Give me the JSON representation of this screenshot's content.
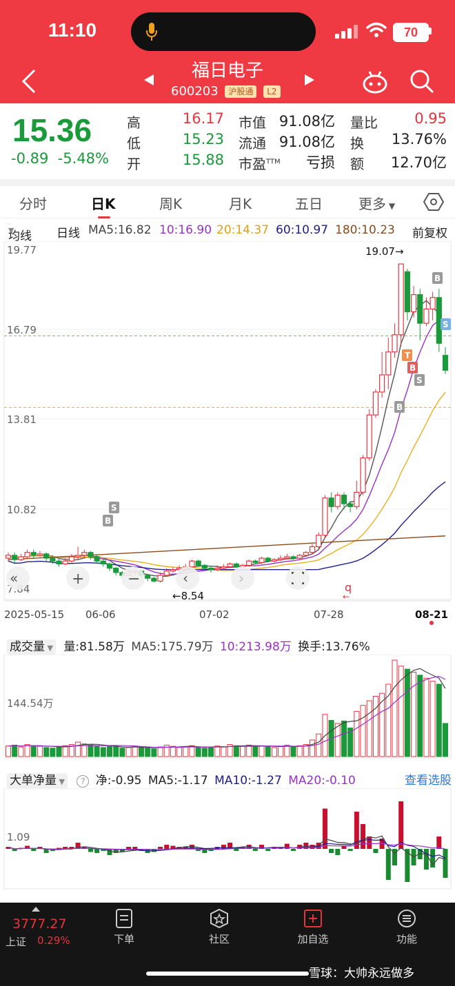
{
  "status": {
    "time": "11:10",
    "battery": "70"
  },
  "header": {
    "name": "福日电子",
    "code": "600203",
    "tag1": "沪股通",
    "tag2": "L2"
  },
  "quote": {
    "price": "15.36",
    "change": "-0.89",
    "change_pct": "-5.48%",
    "stats": [
      {
        "label": "高",
        "value": "16.17",
        "label2": "市值",
        "value2": "91.08亿",
        "label3": "量比",
        "value3": "0.95"
      },
      {
        "label": "低",
        "value": "15.23",
        "label2": "流通",
        "value2": "91.08亿",
        "label3": "换",
        "value3": "13.76%"
      },
      {
        "label": "开",
        "value": "15.88",
        "label2": "市盈",
        "sup2": "TTM",
        "value2": "亏损",
        "label3": "额",
        "value3": "12.70亿"
      }
    ]
  },
  "tabs": [
    "分时",
    "日K",
    "周K",
    "月K",
    "五日",
    "更多"
  ],
  "ma_bar": {
    "selector": "均线",
    "period": "日线",
    "ma5": "MA5:16.82",
    "ma10": "10:16.90",
    "ma20": "20:14.37",
    "ma60": "60:10.97",
    "ma180": "180:10.23",
    "adjust": "前复权"
  },
  "colors": {
    "up": "#e8343f",
    "down": "#1a9a3a",
    "ma5": "#555555",
    "ma10": "#9b30c8",
    "ma20": "#e8b020",
    "ma60": "#1d1d8a",
    "ma180": "#8b4a1a"
  },
  "kline": {
    "y_labels": [
      "19.77",
      "16.79",
      "13.81",
      "10.82",
      "7.84"
    ],
    "high_label": "19.07→",
    "low_label": "←8.54",
    "dates": [
      "2025-05-15",
      "06-06",
      "07-02",
      "07-28",
      "08-21"
    ],
    "markers": {
      "b": "B",
      "s": "S",
      "t": "T"
    },
    "controls": {
      "q": "q"
    },
    "ohlc": [
      [
        8.8,
        8.9,
        8.7,
        9.0
      ],
      [
        8.9,
        8.75,
        8.6,
        9.0
      ],
      [
        8.75,
        8.85,
        8.7,
        8.95
      ],
      [
        8.85,
        9.0,
        8.8,
        9.1
      ],
      [
        9.0,
        8.9,
        8.8,
        9.1
      ],
      [
        8.9,
        8.95,
        8.85,
        9.05
      ],
      [
        8.95,
        8.8,
        8.7,
        9.0
      ],
      [
        8.8,
        8.7,
        8.6,
        8.9
      ],
      [
        8.7,
        8.6,
        8.5,
        8.8
      ],
      [
        8.6,
        8.7,
        8.55,
        8.8
      ],
      [
        8.7,
        8.85,
        8.65,
        8.95
      ],
      [
        8.85,
        8.9,
        8.75,
        9.2
      ],
      [
        8.9,
        9.0,
        8.8,
        9.1
      ],
      [
        9.0,
        8.85,
        8.75,
        9.05
      ],
      [
        8.85,
        8.7,
        8.6,
        8.9
      ],
      [
        8.7,
        8.6,
        8.5,
        8.75
      ],
      [
        8.6,
        8.45,
        8.35,
        8.65
      ],
      [
        8.45,
        8.3,
        8.2,
        8.5
      ],
      [
        8.3,
        8.2,
        8.1,
        8.35
      ],
      [
        8.2,
        8.3,
        8.15,
        8.4
      ],
      [
        8.3,
        8.35,
        8.25,
        8.45
      ],
      [
        8.35,
        8.2,
        8.1,
        8.4
      ],
      [
        8.2,
        8.1,
        8.0,
        8.25
      ],
      [
        8.1,
        8.0,
        7.95,
        8.15
      ],
      [
        8.0,
        8.2,
        7.95,
        8.3
      ],
      [
        8.2,
        8.35,
        8.15,
        8.45
      ],
      [
        8.35,
        8.4,
        8.3,
        8.5
      ],
      [
        8.4,
        8.45,
        8.35,
        8.55
      ],
      [
        8.45,
        8.5,
        8.4,
        8.6
      ],
      [
        8.5,
        8.7,
        8.45,
        8.75
      ],
      [
        8.7,
        8.55,
        8.5,
        8.75
      ],
      [
        8.55,
        8.45,
        8.4,
        8.6
      ],
      [
        8.45,
        8.4,
        8.3,
        8.5
      ],
      [
        8.4,
        8.45,
        8.35,
        8.55
      ],
      [
        8.45,
        8.5,
        8.4,
        8.6
      ],
      [
        8.5,
        8.6,
        8.45,
        8.65
      ],
      [
        8.6,
        8.5,
        8.45,
        8.65
      ],
      [
        8.5,
        8.55,
        8.45,
        8.6
      ],
      [
        8.55,
        8.7,
        8.5,
        8.75
      ],
      [
        8.7,
        8.65,
        8.6,
        8.75
      ],
      [
        8.65,
        8.8,
        8.6,
        8.85
      ],
      [
        8.8,
        8.7,
        8.65,
        8.85
      ],
      [
        8.7,
        8.75,
        8.65,
        8.8
      ],
      [
        8.75,
        8.8,
        8.7,
        8.9
      ],
      [
        8.8,
        8.85,
        8.75,
        8.95
      ],
      [
        8.85,
        8.8,
        8.75,
        8.9
      ],
      [
        8.8,
        8.9,
        8.75,
        8.95
      ],
      [
        8.9,
        9.0,
        8.85,
        9.05
      ],
      [
        9.0,
        9.2,
        8.95,
        9.3
      ],
      [
        9.2,
        9.6,
        9.1,
        9.7
      ],
      [
        9.6,
        10.9,
        9.5,
        11.0
      ],
      [
        10.9,
        10.6,
        10.4,
        11.1
      ],
      [
        10.6,
        11.0,
        10.5,
        11.1
      ],
      [
        11.0,
        10.7,
        10.5,
        11.1
      ],
      [
        10.7,
        10.6,
        10.4,
        10.8
      ],
      [
        10.6,
        11.1,
        10.5,
        11.5
      ],
      [
        11.1,
        12.3,
        11.0,
        12.4
      ],
      [
        12.3,
        13.8,
        12.2,
        14.0
      ],
      [
        13.8,
        14.6,
        13.7,
        14.7
      ],
      [
        14.6,
        15.2,
        14.4,
        16.0
      ],
      [
        15.2,
        16.0,
        14.7,
        16.5
      ],
      [
        16.0,
        16.6,
        15.8,
        17.0
      ],
      [
        16.6,
        19.07,
        16.2,
        19.07
      ],
      [
        18.8,
        17.4,
        17.1,
        18.9
      ],
      [
        17.4,
        18.0,
        17.2,
        18.3
      ],
      [
        18.0,
        17.0,
        16.4,
        18.2
      ],
      [
        17.0,
        17.5,
        16.9,
        17.9
      ],
      [
        17.5,
        17.9,
        17.1,
        18.1
      ],
      [
        17.9,
        16.3,
        16.0,
        18.2
      ],
      [
        15.88,
        15.36,
        15.23,
        16.17
      ]
    ]
  },
  "volume": {
    "selector": "成交量",
    "vol": "量:81.58万",
    "ma5": "MA5:175.79万",
    "ma10": "10:213.98万",
    "turnover": "换手:13.76%",
    "y_label": "144.54万",
    "values": [
      35,
      38,
      32,
      40,
      36,
      34,
      30,
      28,
      33,
      36,
      40,
      48,
      42,
      38,
      34,
      30,
      36,
      32,
      28,
      30,
      34,
      30,
      28,
      26,
      32,
      38,
      34,
      30,
      33,
      36,
      30,
      28,
      32,
      35,
      33,
      40,
      36,
      34,
      38,
      32,
      36,
      34,
      30,
      33,
      38,
      32,
      36,
      40,
      55,
      75,
      140,
      120,
      110,
      118,
      95,
      150,
      170,
      185,
      200,
      210,
      240,
      320,
      300,
      290,
      280,
      270,
      260,
      250,
      240,
      110
    ],
    "up": [
      1,
      0,
      1,
      1,
      0,
      1,
      0,
      0,
      0,
      1,
      1,
      1,
      1,
      0,
      0,
      0,
      0,
      0,
      0,
      1,
      1,
      0,
      0,
      0,
      1,
      1,
      1,
      1,
      1,
      1,
      0,
      0,
      0,
      1,
      1,
      1,
      0,
      1,
      1,
      0,
      1,
      0,
      1,
      1,
      1,
      0,
      1,
      1,
      1,
      1,
      1,
      0,
      1,
      0,
      0,
      1,
      1,
      1,
      1,
      1,
      1,
      1,
      1,
      0,
      1,
      0,
      1,
      1,
      0,
      0
    ]
  },
  "netflow": {
    "selector": "大单净量",
    "net": "净:-0.95",
    "ma5": "MA5:-1.17",
    "ma10": "MA10:-1.27",
    "ma20": "MA20:-0.10",
    "link": "查看选股",
    "y_label": "1.09",
    "values": [
      0.1,
      -0.1,
      0.05,
      0.15,
      -0.1,
      0.1,
      -0.2,
      -0.1,
      0.05,
      0.1,
      0.1,
      0.3,
      0.1,
      -0.15,
      -0.2,
      -0.1,
      -0.3,
      -0.2,
      -0.15,
      0.1,
      0.1,
      -0.1,
      -0.2,
      -0.15,
      0.1,
      0.2,
      0.15,
      0.1,
      0.1,
      0.2,
      -0.1,
      -0.2,
      -0.1,
      0.1,
      0.2,
      0.3,
      -0.1,
      0.1,
      0.2,
      -0.1,
      0.2,
      -0.1,
      0.1,
      0.1,
      0.25,
      -0.1,
      0.2,
      0.3,
      0.2,
      0.3,
      1.95,
      -0.2,
      -0.3,
      0.15,
      -0.1,
      1.8,
      1.2,
      0.6,
      -0.2,
      0.5,
      -1.5,
      -0.8,
      2.3,
      -1.6,
      -0.8,
      -0.5,
      -1.0,
      -0.9,
      0.6,
      -1.4
    ]
  },
  "bottom": {
    "index_value": "3777.27",
    "index_name": "上证",
    "index_pct": "0.29%",
    "items": [
      "下单",
      "社区",
      "加自选",
      "功能"
    ],
    "watermark": "雪球：大帅永远做多"
  }
}
